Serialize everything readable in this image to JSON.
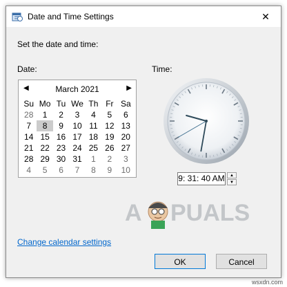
{
  "window": {
    "title": "Date and Time Settings",
    "close_glyph": "✕"
  },
  "main": {
    "heading": "Set the date and time:",
    "date_label": "Date:",
    "time_label": "Time:"
  },
  "calendar": {
    "month_label": "March 2021",
    "prev_glyph": "◀",
    "next_glyph": "▶",
    "weekdays": [
      "Su",
      "Mo",
      "Tu",
      "We",
      "Th",
      "Fr",
      "Sa"
    ],
    "weeks": [
      [
        {
          "d": "28",
          "dim": true
        },
        {
          "d": "1"
        },
        {
          "d": "2"
        },
        {
          "d": "3"
        },
        {
          "d": "4"
        },
        {
          "d": "5"
        },
        {
          "d": "6"
        }
      ],
      [
        {
          "d": "7"
        },
        {
          "d": "8",
          "selected": true
        },
        {
          "d": "9"
        },
        {
          "d": "10"
        },
        {
          "d": "11"
        },
        {
          "d": "12"
        },
        {
          "d": "13"
        }
      ],
      [
        {
          "d": "14"
        },
        {
          "d": "15"
        },
        {
          "d": "16"
        },
        {
          "d": "17"
        },
        {
          "d": "18"
        },
        {
          "d": "19"
        },
        {
          "d": "20"
        }
      ],
      [
        {
          "d": "21"
        },
        {
          "d": "22"
        },
        {
          "d": "23"
        },
        {
          "d": "24"
        },
        {
          "d": "25"
        },
        {
          "d": "26"
        },
        {
          "d": "27"
        }
      ],
      [
        {
          "d": "28"
        },
        {
          "d": "29"
        },
        {
          "d": "30"
        },
        {
          "d": "31"
        },
        {
          "d": "1",
          "dim": true
        },
        {
          "d": "2",
          "dim": true
        },
        {
          "d": "3",
          "dim": true
        }
      ],
      [
        {
          "d": "4",
          "dim": true
        },
        {
          "d": "5",
          "dim": true
        },
        {
          "d": "6",
          "dim": true
        },
        {
          "d": "7",
          "dim": true
        },
        {
          "d": "8",
          "dim": true
        },
        {
          "d": "9",
          "dim": true
        },
        {
          "d": "10",
          "dim": true
        }
      ]
    ],
    "selected_color": "#cccccc"
  },
  "time": {
    "value": "9: 31: 40 AM",
    "clock": {
      "hour": 9,
      "minute": 31,
      "second": 40
    },
    "spin_up_glyph": "▲",
    "spin_down_glyph": "▼"
  },
  "watermark": {
    "text_left": "A",
    "text_right": "PUALS"
  },
  "footer": {
    "calendar_link": "Change calendar settings",
    "ok_label": "OK",
    "cancel_label": "Cancel",
    "site": "wsxdn.com"
  },
  "colors": {
    "link": "#0066cc",
    "accent": "#0078d7",
    "dialog_bg": "#f0f0f0"
  },
  "icons": {
    "title": "date-time-icon",
    "close": "close-icon",
    "prev": "chevron-left-icon",
    "next": "chevron-right-icon"
  }
}
